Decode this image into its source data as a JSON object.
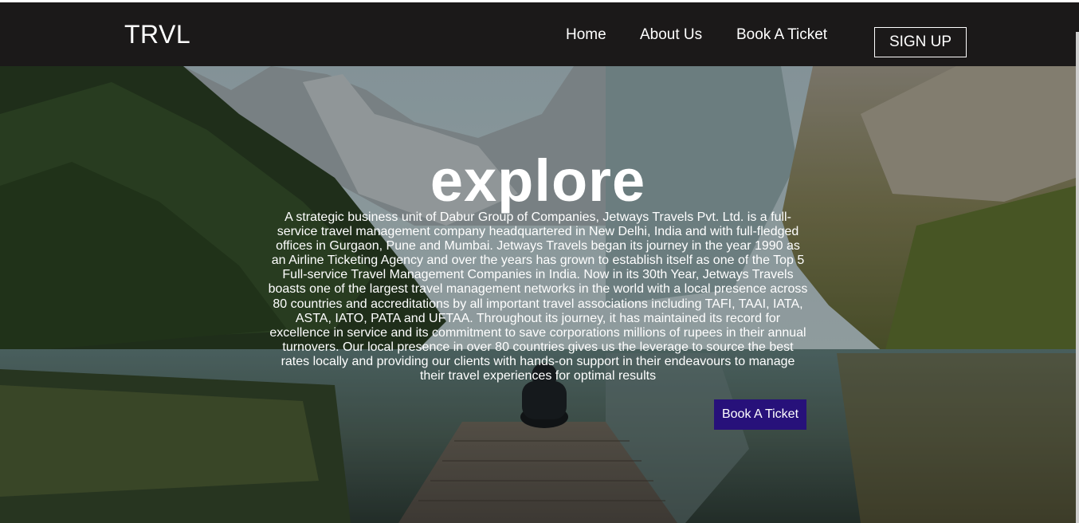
{
  "navbar": {
    "brand": "TRVL",
    "links": [
      "Home",
      "About Us",
      "Book A Ticket"
    ],
    "signup_label": "SIGN UP"
  },
  "hero": {
    "title": "explore",
    "description": "A strategic business unit of Dabur Group of Companies, Jetways Travels Pvt. Ltd. is a full-service travel management company headquartered in New Delhi, India and with full-fledged offices in Gurgaon, Pune and Mumbai. Jetways Travels began its journey in the year 1990 as an Airline Ticketing Agency and over the years has grown to establish itself as one of the Top 5 Full-service Travel Management Companies in India. Now in its 30th Year, Jetways Travels boasts one of the largest travel management networks in the world with a local presence across 80 countries and accreditations by all important travel associations including TAFI, TAAI, IATA, ASTA, IATO, PATA and UFTAA. Throughout its journey, it has maintained its record for excellence in service and its commitment to save corporations millions of rupees in their annual turnovers. Our local presence in over 80 countries gives us the leverage to source the best rates locally and providing our clients with hands-on support in their endeavours to manage their travel experiences for optimal results",
    "cta_label": "Book A Ticket",
    "background_image": "mountain-lake-dock-photo"
  },
  "colors": {
    "navbar_bg": "#1b1919",
    "cta_bg": "#27117a",
    "text": "#ffffff"
  }
}
